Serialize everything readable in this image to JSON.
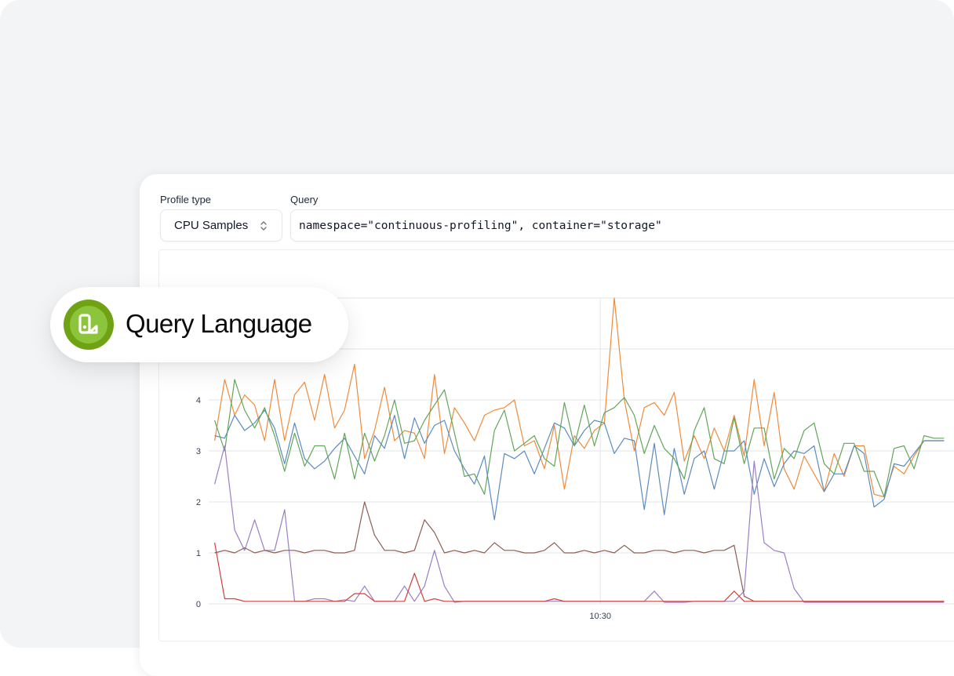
{
  "profile_type": {
    "label": "Profile type",
    "value": "CPU Samples"
  },
  "query": {
    "label": "Query",
    "value": "namespace=\"continuous-profiling\", container=\"storage\""
  },
  "badge": {
    "text": "Query Language",
    "icon": "query-language-logo-icon",
    "accent_color": "#7ab317"
  },
  "chart_data": {
    "type": "line",
    "ylim": [
      0,
      6
    ],
    "yticks": [
      0,
      1,
      2,
      3,
      4
    ],
    "ytick_labels": [
      "0",
      "1",
      "2",
      "3",
      "4"
    ],
    "x_count": 74,
    "xlim": [
      -0.6,
      74
    ],
    "x_tick": {
      "index": 38.6,
      "label": "10:30"
    },
    "grid": true,
    "series": [
      {
        "color": "#ef8b3c",
        "values": [
          3.2,
          4.4,
          3.7,
          4.1,
          3.9,
          3.2,
          4.4,
          3.2,
          4.1,
          4.35,
          3.6,
          4.5,
          3.45,
          3.8,
          4.7,
          2.85,
          3.4,
          4.25,
          3.2,
          3.4,
          3.35,
          2.85,
          4.5,
          2.95,
          3.85,
          3.55,
          3.2,
          3.7,
          3.8,
          3.85,
          4.0,
          3.1,
          3.2,
          2.65,
          3.5,
          2.25,
          3.3,
          3.05,
          3.4,
          3.55,
          6.0,
          4.0,
          3.0,
          3.85,
          3.95,
          3.7,
          4.15,
          2.8,
          3.3,
          2.85,
          3.45,
          3.0,
          3.7,
          2.9,
          4.4,
          3.1,
          4.15,
          2.65,
          2.25,
          2.9,
          2.55,
          2.2,
          2.95,
          2.5,
          3.1,
          3.1,
          2.15,
          2.1,
          2.7,
          2.55,
          2.9,
          3.2,
          3.2,
          3.2
        ]
      },
      {
        "color": "#5b8bbf",
        "values": [
          3.3,
          3.25,
          3.7,
          3.4,
          3.55,
          3.8,
          3.45,
          2.75,
          3.55,
          2.85,
          2.65,
          2.8,
          3.05,
          3.25,
          2.9,
          2.55,
          3.3,
          3.05,
          3.7,
          2.85,
          3.65,
          3.15,
          3.5,
          3.6,
          3.0,
          2.65,
          2.35,
          2.9,
          1.65,
          2.95,
          2.85,
          3.0,
          2.55,
          3.05,
          3.55,
          3.45,
          3.1,
          3.4,
          3.6,
          3.55,
          2.95,
          3.25,
          3.2,
          1.85,
          3.15,
          1.75,
          3.05,
          2.15,
          2.85,
          3.0,
          2.25,
          3.0,
          3.0,
          3.2,
          2.15,
          2.85,
          2.3,
          2.75,
          3.0,
          2.95,
          3.1,
          2.2,
          2.55,
          2.55,
          3.1,
          2.95,
          1.9,
          2.05,
          2.75,
          2.7,
          2.95,
          3.2,
          3.2,
          3.2
        ]
      },
      {
        "color": "#62a65a",
        "values": [
          3.6,
          3.0,
          4.4,
          3.8,
          3.45,
          3.85,
          3.3,
          2.6,
          3.35,
          2.7,
          3.1,
          3.1,
          2.45,
          3.35,
          2.45,
          3.35,
          2.8,
          3.3,
          4.0,
          3.15,
          3.2,
          3.6,
          3.9,
          4.2,
          3.35,
          2.5,
          2.55,
          2.15,
          3.4,
          3.8,
          3.0,
          3.15,
          3.3,
          2.85,
          2.7,
          3.95,
          3.1,
          3.9,
          3.1,
          3.75,
          3.85,
          4.05,
          3.7,
          2.95,
          3.5,
          3.05,
          2.85,
          2.45,
          3.4,
          3.85,
          2.85,
          2.75,
          3.65,
          2.75,
          3.45,
          3.45,
          2.45,
          3.05,
          2.85,
          3.4,
          3.55,
          2.75,
          2.55,
          3.15,
          3.15,
          2.6,
          2.6,
          2.1,
          3.05,
          3.1,
          2.65,
          3.3,
          3.25,
          3.25
        ]
      },
      {
        "color": "#9a7fc3",
        "values": [
          2.35,
          3.1,
          1.45,
          1.05,
          1.65,
          1.05,
          1.05,
          1.85,
          0.05,
          0.05,
          0.1,
          0.1,
          0.05,
          0.08,
          0.05,
          0.35,
          0.05,
          0.05,
          0.05,
          0.35,
          0.05,
          0.35,
          1.05,
          0.35,
          0.03,
          0.05,
          0.05,
          0.05,
          0.05,
          0.05,
          0.05,
          0.05,
          0.05,
          0.05,
          0.05,
          0.05,
          0.05,
          0.05,
          0.05,
          0.05,
          0.05,
          0.05,
          0.05,
          0.05,
          0.25,
          0.03,
          0.03,
          0.03,
          0.05,
          0.05,
          0.05,
          0.05,
          0.05,
          0.25,
          2.8,
          1.2,
          1.05,
          1.0,
          0.3,
          0.03,
          0.03,
          0.03,
          0.03,
          0.03,
          0.03,
          0.03,
          0.03,
          0.03,
          0.03,
          0.03,
          0.03,
          0.03,
          0.03,
          0.03
        ]
      },
      {
        "color": "#8c5d54",
        "values": [
          1.0,
          1.05,
          1.0,
          1.1,
          1.0,
          1.05,
          1.0,
          1.05,
          1.05,
          1.0,
          1.05,
          1.05,
          1.0,
          1.0,
          1.05,
          2.0,
          1.35,
          1.05,
          1.05,
          1.0,
          1.05,
          1.65,
          1.4,
          1.0,
          1.05,
          1.0,
          1.05,
          1.0,
          1.2,
          1.05,
          1.05,
          1.0,
          1.0,
          1.05,
          1.2,
          1.0,
          1.0,
          1.05,
          1.0,
          1.05,
          1.0,
          1.15,
          1.0,
          1.0,
          1.05,
          1.05,
          1.0,
          1.05,
          1.05,
          1.0,
          1.05,
          1.05,
          1.15,
          0.15,
          0.05,
          0.05,
          0.05,
          0.05,
          0.05,
          0.05,
          0.05,
          0.05,
          0.05,
          0.05,
          0.05,
          0.05,
          0.05,
          0.05,
          0.05,
          0.05,
          0.05,
          0.05,
          0.05,
          0.05
        ]
      },
      {
        "color": "#d0403c",
        "values": [
          1.2,
          0.1,
          0.1,
          0.05,
          0.05,
          0.05,
          0.05,
          0.05,
          0.05,
          0.05,
          0.05,
          0.05,
          0.05,
          0.05,
          0.2,
          0.2,
          0.05,
          0.05,
          0.05,
          0.05,
          0.6,
          0.05,
          0.1,
          0.05,
          0.05,
          0.05,
          0.05,
          0.05,
          0.05,
          0.05,
          0.05,
          0.05,
          0.05,
          0.05,
          0.1,
          0.05,
          0.05,
          0.05,
          0.05,
          0.05,
          0.05,
          0.05,
          0.05,
          0.05,
          0.05,
          0.05,
          0.05,
          0.05,
          0.05,
          0.05,
          0.05,
          0.05,
          0.25,
          0.05,
          0.05,
          0.05,
          0.05,
          0.05,
          0.05,
          0.05,
          0.05,
          0.05,
          0.05,
          0.05,
          0.05,
          0.05,
          0.05,
          0.05,
          0.05,
          0.05,
          0.05,
          0.05,
          0.05,
          0.05
        ]
      }
    ]
  }
}
